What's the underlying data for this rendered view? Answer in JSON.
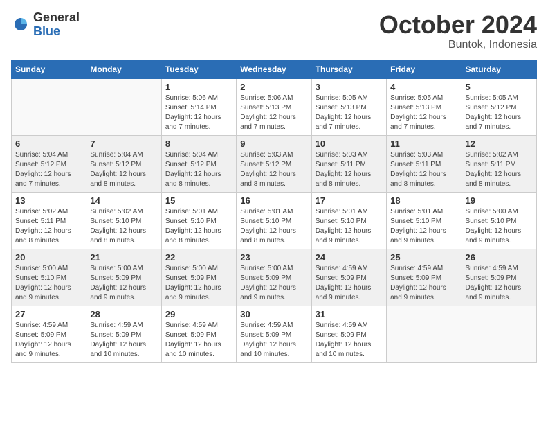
{
  "logo": {
    "general": "General",
    "blue": "Blue"
  },
  "header": {
    "month": "October 2024",
    "location": "Buntok, Indonesia"
  },
  "weekdays": [
    "Sunday",
    "Monday",
    "Tuesday",
    "Wednesday",
    "Thursday",
    "Friday",
    "Saturday"
  ],
  "weeks": [
    {
      "shaded": false,
      "days": [
        {
          "num": "",
          "info": ""
        },
        {
          "num": "",
          "info": ""
        },
        {
          "num": "1",
          "info": "Sunrise: 5:06 AM\nSunset: 5:14 PM\nDaylight: 12 hours\nand 7 minutes."
        },
        {
          "num": "2",
          "info": "Sunrise: 5:06 AM\nSunset: 5:13 PM\nDaylight: 12 hours\nand 7 minutes."
        },
        {
          "num": "3",
          "info": "Sunrise: 5:05 AM\nSunset: 5:13 PM\nDaylight: 12 hours\nand 7 minutes."
        },
        {
          "num": "4",
          "info": "Sunrise: 5:05 AM\nSunset: 5:13 PM\nDaylight: 12 hours\nand 7 minutes."
        },
        {
          "num": "5",
          "info": "Sunrise: 5:05 AM\nSunset: 5:12 PM\nDaylight: 12 hours\nand 7 minutes."
        }
      ]
    },
    {
      "shaded": true,
      "days": [
        {
          "num": "6",
          "info": "Sunrise: 5:04 AM\nSunset: 5:12 PM\nDaylight: 12 hours\nand 7 minutes."
        },
        {
          "num": "7",
          "info": "Sunrise: 5:04 AM\nSunset: 5:12 PM\nDaylight: 12 hours\nand 8 minutes."
        },
        {
          "num": "8",
          "info": "Sunrise: 5:04 AM\nSunset: 5:12 PM\nDaylight: 12 hours\nand 8 minutes."
        },
        {
          "num": "9",
          "info": "Sunrise: 5:03 AM\nSunset: 5:12 PM\nDaylight: 12 hours\nand 8 minutes."
        },
        {
          "num": "10",
          "info": "Sunrise: 5:03 AM\nSunset: 5:11 PM\nDaylight: 12 hours\nand 8 minutes."
        },
        {
          "num": "11",
          "info": "Sunrise: 5:03 AM\nSunset: 5:11 PM\nDaylight: 12 hours\nand 8 minutes."
        },
        {
          "num": "12",
          "info": "Sunrise: 5:02 AM\nSunset: 5:11 PM\nDaylight: 12 hours\nand 8 minutes."
        }
      ]
    },
    {
      "shaded": false,
      "days": [
        {
          "num": "13",
          "info": "Sunrise: 5:02 AM\nSunset: 5:11 PM\nDaylight: 12 hours\nand 8 minutes."
        },
        {
          "num": "14",
          "info": "Sunrise: 5:02 AM\nSunset: 5:10 PM\nDaylight: 12 hours\nand 8 minutes."
        },
        {
          "num": "15",
          "info": "Sunrise: 5:01 AM\nSunset: 5:10 PM\nDaylight: 12 hours\nand 8 minutes."
        },
        {
          "num": "16",
          "info": "Sunrise: 5:01 AM\nSunset: 5:10 PM\nDaylight: 12 hours\nand 8 minutes."
        },
        {
          "num": "17",
          "info": "Sunrise: 5:01 AM\nSunset: 5:10 PM\nDaylight: 12 hours\nand 9 minutes."
        },
        {
          "num": "18",
          "info": "Sunrise: 5:01 AM\nSunset: 5:10 PM\nDaylight: 12 hours\nand 9 minutes."
        },
        {
          "num": "19",
          "info": "Sunrise: 5:00 AM\nSunset: 5:10 PM\nDaylight: 12 hours\nand 9 minutes."
        }
      ]
    },
    {
      "shaded": true,
      "days": [
        {
          "num": "20",
          "info": "Sunrise: 5:00 AM\nSunset: 5:10 PM\nDaylight: 12 hours\nand 9 minutes."
        },
        {
          "num": "21",
          "info": "Sunrise: 5:00 AM\nSunset: 5:09 PM\nDaylight: 12 hours\nand 9 minutes."
        },
        {
          "num": "22",
          "info": "Sunrise: 5:00 AM\nSunset: 5:09 PM\nDaylight: 12 hours\nand 9 minutes."
        },
        {
          "num": "23",
          "info": "Sunrise: 5:00 AM\nSunset: 5:09 PM\nDaylight: 12 hours\nand 9 minutes."
        },
        {
          "num": "24",
          "info": "Sunrise: 4:59 AM\nSunset: 5:09 PM\nDaylight: 12 hours\nand 9 minutes."
        },
        {
          "num": "25",
          "info": "Sunrise: 4:59 AM\nSunset: 5:09 PM\nDaylight: 12 hours\nand 9 minutes."
        },
        {
          "num": "26",
          "info": "Sunrise: 4:59 AM\nSunset: 5:09 PM\nDaylight: 12 hours\nand 9 minutes."
        }
      ]
    },
    {
      "shaded": false,
      "days": [
        {
          "num": "27",
          "info": "Sunrise: 4:59 AM\nSunset: 5:09 PM\nDaylight: 12 hours\nand 9 minutes."
        },
        {
          "num": "28",
          "info": "Sunrise: 4:59 AM\nSunset: 5:09 PM\nDaylight: 12 hours\nand 10 minutes."
        },
        {
          "num": "29",
          "info": "Sunrise: 4:59 AM\nSunset: 5:09 PM\nDaylight: 12 hours\nand 10 minutes."
        },
        {
          "num": "30",
          "info": "Sunrise: 4:59 AM\nSunset: 5:09 PM\nDaylight: 12 hours\nand 10 minutes."
        },
        {
          "num": "31",
          "info": "Sunrise: 4:59 AM\nSunset: 5:09 PM\nDaylight: 12 hours\nand 10 minutes."
        },
        {
          "num": "",
          "info": ""
        },
        {
          "num": "",
          "info": ""
        }
      ]
    }
  ]
}
